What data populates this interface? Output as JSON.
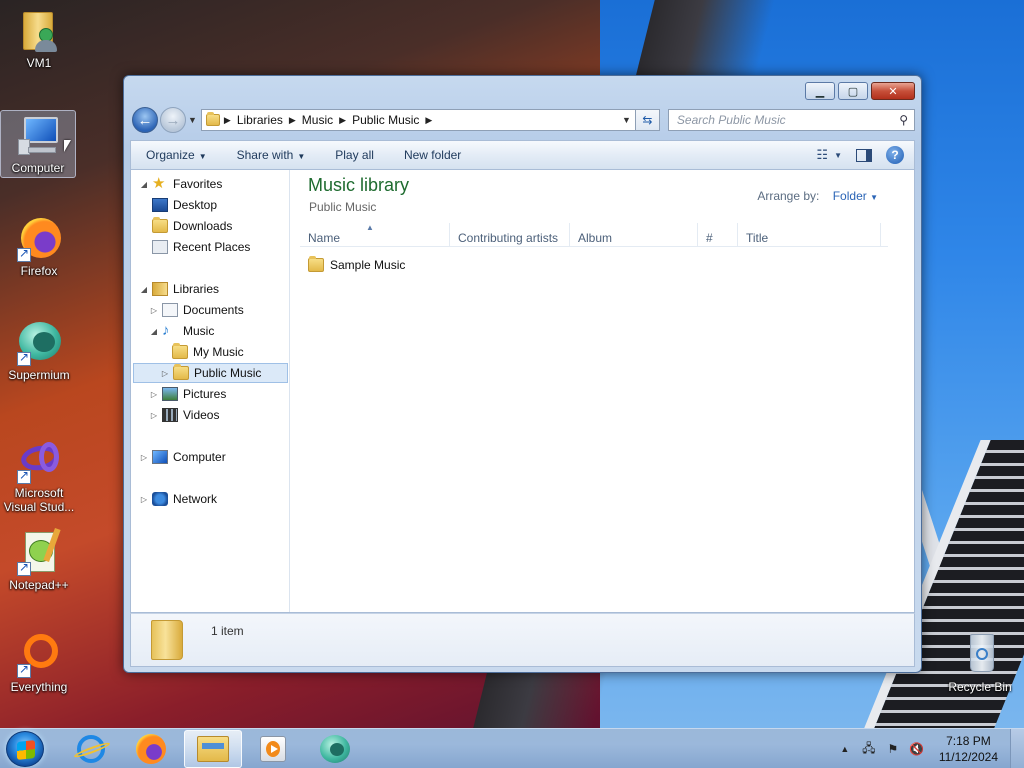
{
  "desktop": {
    "icons": [
      {
        "label": "VM1",
        "icon": "user-folder-icon"
      },
      {
        "label": "Computer",
        "icon": "computer-icon"
      },
      {
        "label": "Firefox",
        "icon": "firefox-icon"
      },
      {
        "label": "Supermium",
        "icon": "supermium-icon"
      },
      {
        "label": "Microsoft Visual Stud...",
        "icon": "visual-studio-icon"
      },
      {
        "label": "Notepad++",
        "icon": "notepadpp-icon"
      },
      {
        "label": "Everything",
        "icon": "everything-icon"
      },
      {
        "label": "Recycle Bin",
        "icon": "recycle-bin-icon"
      }
    ]
  },
  "window": {
    "caption": {
      "minimize": "▁",
      "maximize": "▢",
      "close": "✕"
    },
    "address": {
      "crumbs": [
        "Libraries",
        "Music",
        "Public Music"
      ]
    },
    "search": {
      "placeholder": "Search Public Music"
    },
    "commands": {
      "organize": "Organize",
      "share_with": "Share with",
      "play_all": "Play all",
      "new_folder": "New folder"
    },
    "nav": {
      "favorites": "Favorites",
      "desktop": "Desktop",
      "downloads": "Downloads",
      "recent_places": "Recent Places",
      "libraries": "Libraries",
      "documents": "Documents",
      "music": "Music",
      "my_music": "My Music",
      "public_music": "Public Music",
      "pictures": "Pictures",
      "videos": "Videos",
      "computer": "Computer",
      "network": "Network"
    },
    "content": {
      "title": "Music library",
      "subtitle": "Public Music",
      "arrange_label": "Arrange by:",
      "arrange_value": "Folder",
      "columns": [
        "Name",
        "Contributing artists",
        "Album",
        "#",
        "Title"
      ],
      "items": [
        {
          "name": "Sample Music",
          "icon": "folder-icon"
        }
      ]
    },
    "details": {
      "count": "1 item"
    }
  },
  "taskbar": {
    "clock_time": "7:18 PM",
    "clock_date": "11/12/2024"
  },
  "colors": {
    "library_title": "#1e6b2f",
    "selection": "#dbe9f8",
    "link": "#2a64b6"
  }
}
